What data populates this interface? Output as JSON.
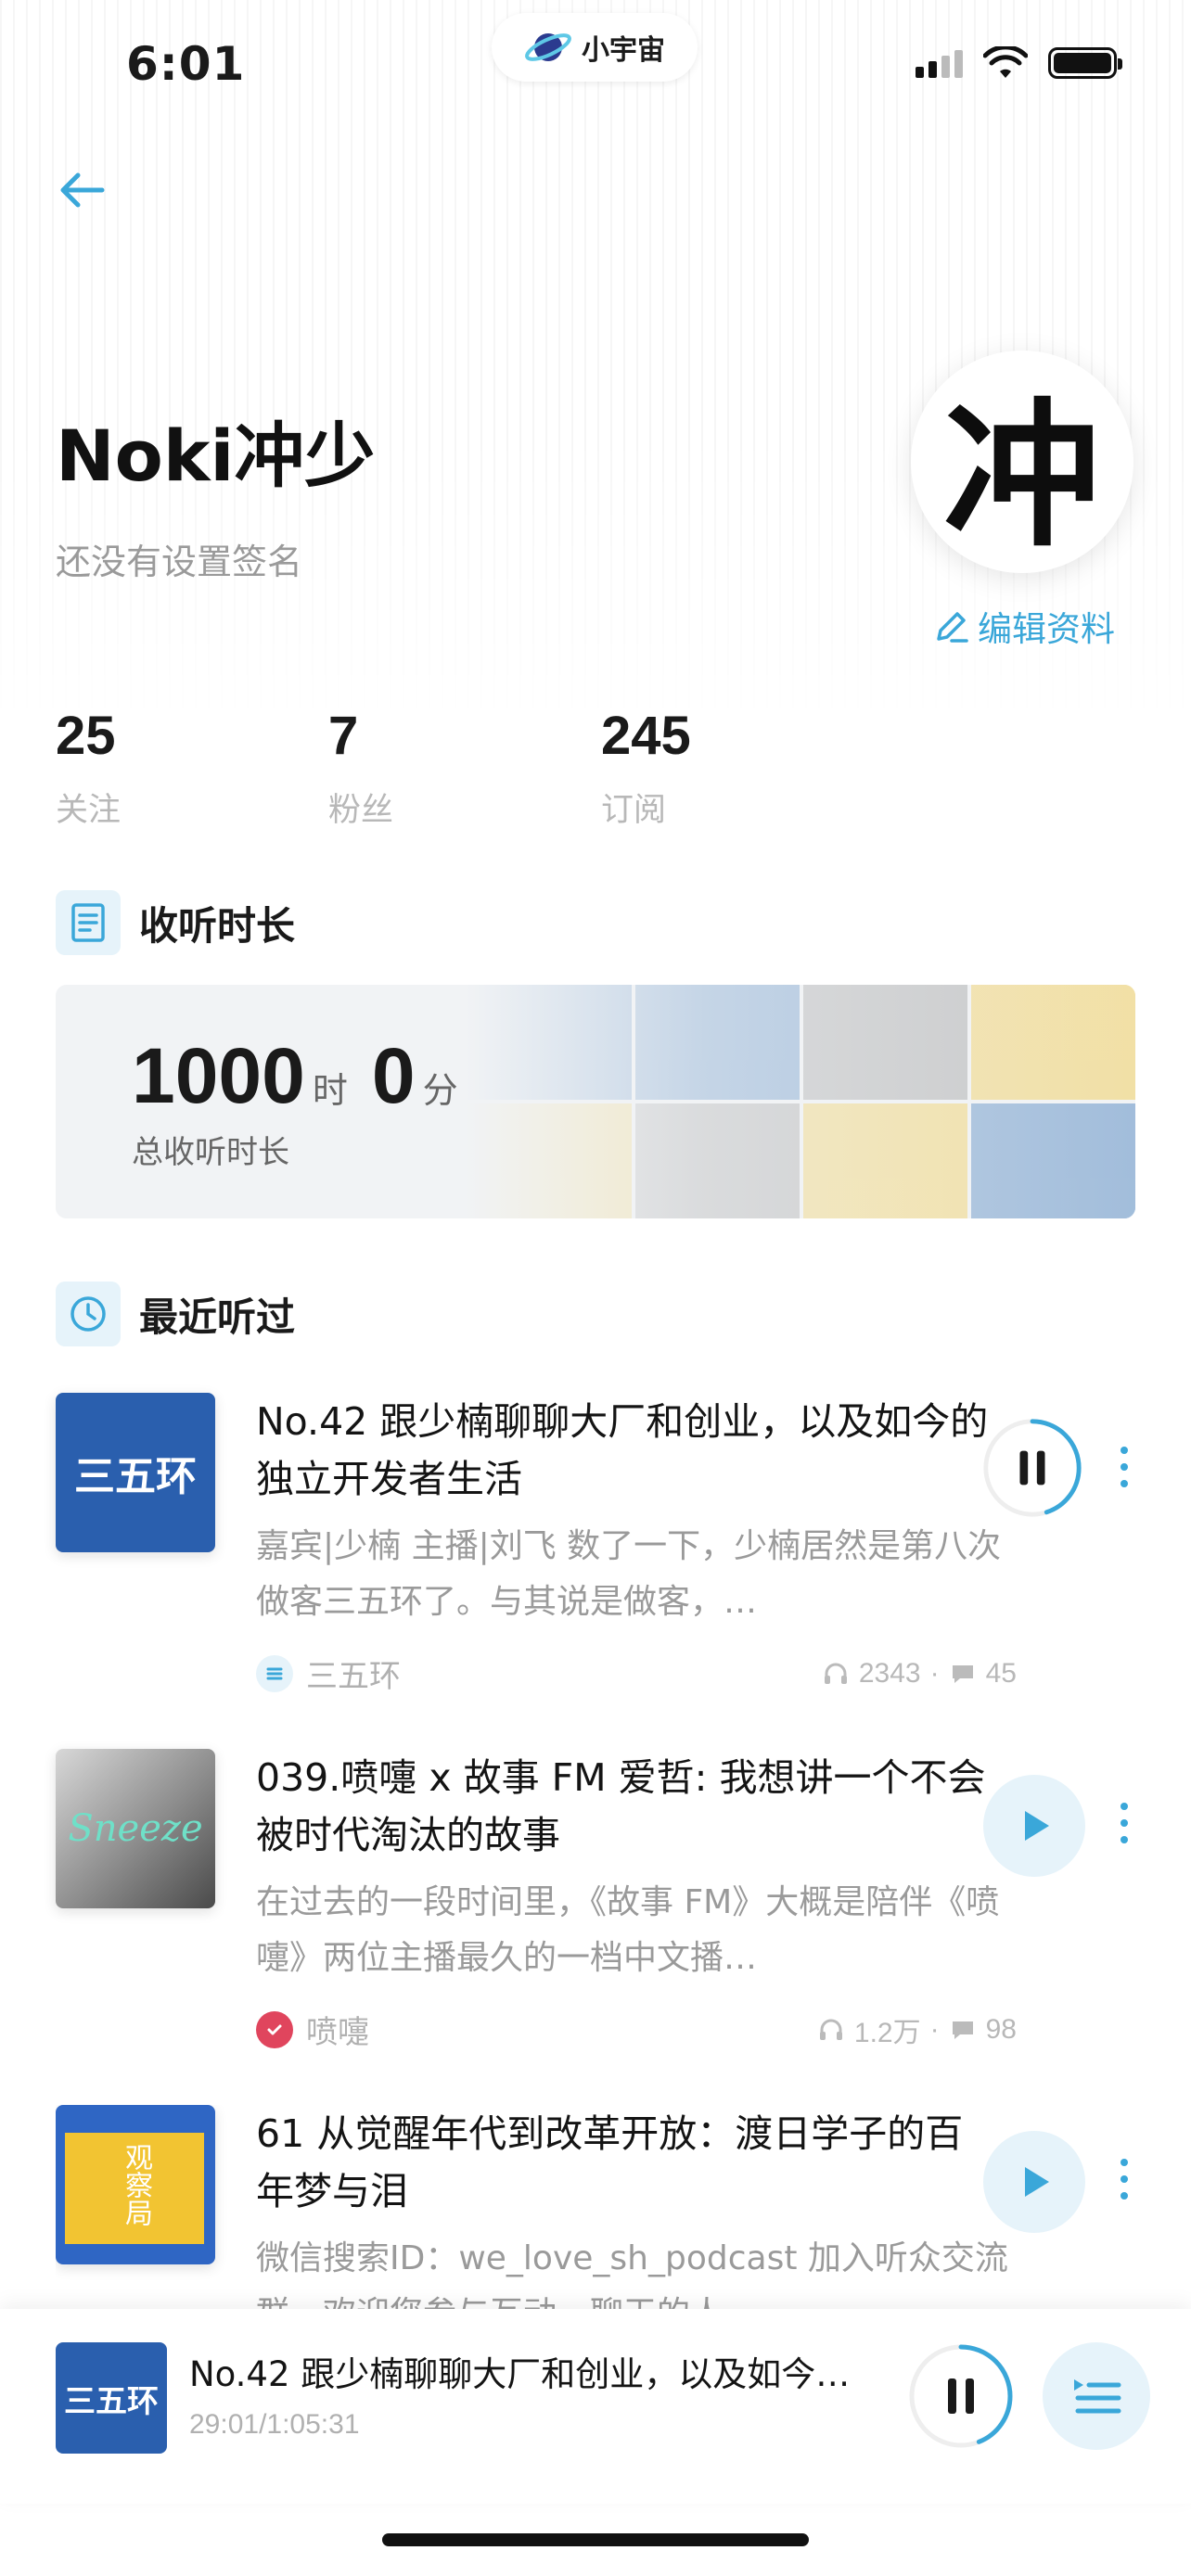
{
  "status_bar": {
    "time": "6:01",
    "app_name": "小宇宙"
  },
  "profile": {
    "name": "Noki冲少",
    "signature": "还没有设置签名",
    "avatar_char": "冲",
    "edit_label": "编辑资料"
  },
  "stats": [
    {
      "value": "25",
      "label": "关注"
    },
    {
      "value": "7",
      "label": "粉丝"
    },
    {
      "value": "245",
      "label": "订阅"
    }
  ],
  "listening": {
    "section_title": "收听时长",
    "hours": "1000",
    "hours_unit": "时",
    "minutes": "0",
    "minutes_unit": "分",
    "caption": "总收听时长"
  },
  "recent": {
    "section_title": "最近听过",
    "episodes": [
      {
        "title": "No.42 跟少楠聊聊大厂和创业，以及如今的独立开发者生活",
        "description": "嘉宾|少楠 主播|刘飞 数了一下，少楠居然是第八次做客三五环了。与其说是做客，…",
        "podcast": "三五环",
        "plays": "2343",
        "comments": "45",
        "cover_text": "三五环",
        "state": "playing",
        "progress_pct": 45
      },
      {
        "title": "039.喷嚏 x 故事 FM 爱哲: 我想讲一个不会被时代淘汰的故事",
        "description": "在过去的一段时间里，《故事 FM》大概是陪伴《喷嚏》两位主播最久的一档中文播…",
        "podcast": "喷嚏",
        "plays": "1.2万",
        "comments": "98",
        "cover_text": "Sneeze",
        "state": "paused"
      },
      {
        "title": "61 从觉醒年代到改革开放：渡日学子的百年梦与泪",
        "description": "微信搜索ID：we_love_sh_podcast 加入听众交流群，欢迎您参与互动，聊天的人…",
        "podcast": "",
        "plays": "",
        "comments": "",
        "cover_text": "观察局",
        "state": "paused"
      }
    ]
  },
  "mini_player": {
    "cover_text": "三五环",
    "title": "No.42 跟少楠聊聊大厂和创业，以及如今…",
    "progress": "29:01/1:05:31",
    "progress_pct": 44
  },
  "colors": {
    "accent": "#3aa7d9",
    "accent_light": "#e6f3fa",
    "sneeze_badge": "#e0455d"
  }
}
